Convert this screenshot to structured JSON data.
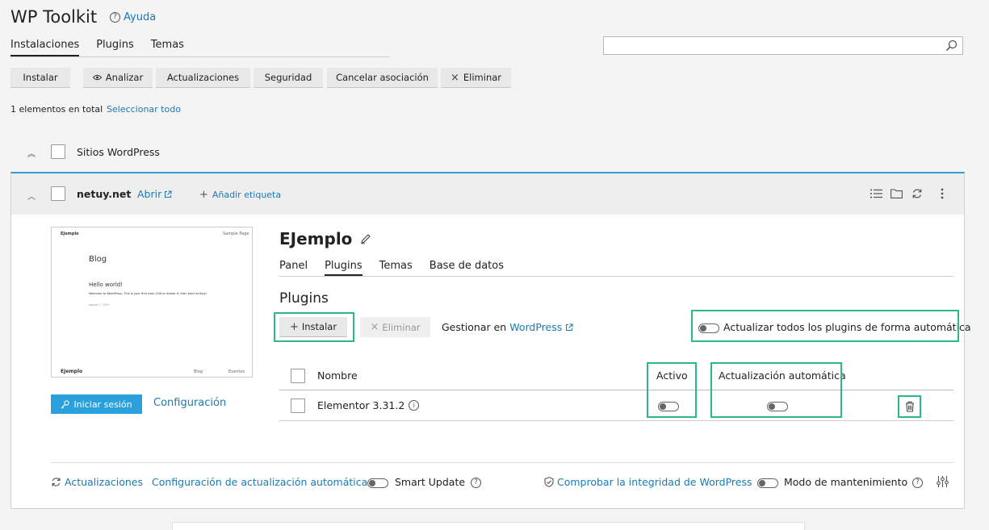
{
  "app": {
    "title": "WP Toolkit",
    "help_label": "Ayuda"
  },
  "main_tabs": [
    {
      "label": "Instalaciones",
      "active": true
    },
    {
      "label": "Plugins",
      "active": false
    },
    {
      "label": "Temas",
      "active": false
    }
  ],
  "search": {
    "value": "",
    "placeholder": ""
  },
  "toolbar": {
    "install": "Instalar",
    "analyze": "Analizar",
    "updates": "Actualizaciones",
    "security": "Seguridad",
    "detach": "Cancelar asociación",
    "remove": "Eliminar"
  },
  "summary": {
    "count_text": "1 elementos en total",
    "select_all": "Seleccionar todo"
  },
  "group": {
    "label": "Sitios WordPress"
  },
  "site": {
    "domain": "netuy.net",
    "open_label": "Abrir",
    "add_tag_label": "Añadir etiqueta",
    "name": "EJemplo",
    "login_button": "Iniciar sesión",
    "config_link": "Configuración",
    "preview": {
      "site_name": "EJemplo",
      "sample_page": "Sample Page",
      "blog_title": "Blog",
      "post_title": "Hello world!",
      "post_body": "Welcome to WordPress. This is your first post. Edit or delete it, then start writing!",
      "post_date": "agosto 7, 2025",
      "footer_name": "EJemplo",
      "footer_blog": "Blog",
      "footer_events": "Eventos"
    }
  },
  "site_tabs": [
    {
      "label": "Panel",
      "active": false
    },
    {
      "label": "Plugins",
      "active": true
    },
    {
      "label": "Temas",
      "active": false
    },
    {
      "label": "Base de datos",
      "active": false
    }
  ],
  "plugins": {
    "heading": "Plugins",
    "install": "Instalar",
    "remove": "Eliminar",
    "manage_prefix": "Gestionar en",
    "manage_link": "WordPress",
    "autoupdate_all": "Actualizar todos los plugins de forma automática",
    "columns": {
      "name": "Nombre",
      "active": "Activo",
      "autoupdate": "Actualización automática"
    },
    "rows": [
      {
        "name": "Elementor 3.31.2",
        "active": false,
        "autoupdate": false
      }
    ]
  },
  "footer": {
    "updates": "Actualizaciones",
    "autoupdate_config": "Configuración de actualización automática",
    "smart_update": "Smart Update",
    "integrity": "Comprobar la integridad de WordPress",
    "maintenance": "Modo de mantenimiento"
  },
  "colors": {
    "accent": "#2aa0dd",
    "link": "#1a7ab5",
    "highlight": "#2cb889"
  }
}
